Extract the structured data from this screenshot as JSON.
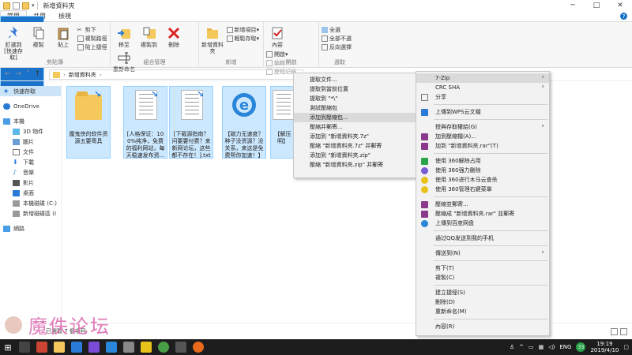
{
  "window": {
    "title": "新增資料夾",
    "controls": [
      "─",
      "□",
      "✕"
    ]
  },
  "tabs": [
    {
      "label": "檔案"
    },
    {
      "label": "常用"
    },
    {
      "label": "共用"
    },
    {
      "label": "檢視"
    }
  ],
  "ribbon": {
    "clipboard": {
      "group_label": "剪貼簿",
      "pin_label": "釘選到 [快速存取]",
      "copy_label": "複製",
      "paste_label": "貼上",
      "cut_label": "剪下",
      "copy_path_label": "複製路徑",
      "paste_shortcut_label": "貼上捷徑"
    },
    "organize": {
      "group_label": "組合管理",
      "move_label": "移至",
      "copy_to_label": "複製到",
      "delete_label": "刪除",
      "rename_label": "重新命名"
    },
    "new": {
      "group_label": "新增",
      "new_folder_label": "新增資料夾",
      "new_item_label": "新增項目",
      "easy_access_label": "輕鬆存取"
    },
    "open": {
      "group_label": "開啟",
      "properties_label": "內容",
      "open_label": "開啟",
      "edit_label": "編輯",
      "history_label": "歷程記錄"
    },
    "select": {
      "group_label": "選取",
      "select_all_label": "全選",
      "select_none_label": "全部不選",
      "invert_label": "反向選擇"
    }
  },
  "address": {
    "path": "新增資料夾"
  },
  "sidebar": {
    "items": [
      {
        "label": "快速存取",
        "icon": "star-icon"
      },
      {
        "label": "OneDrive",
        "icon": "cloud-icon"
      },
      {
        "label": "本機",
        "icon": "computer-icon"
      },
      {
        "label": "3D 物件",
        "icon": "cube-icon"
      },
      {
        "label": "圖片",
        "icon": "picture-icon"
      },
      {
        "label": "文件",
        "icon": "document-icon"
      },
      {
        "label": "下載",
        "icon": "download-icon"
      },
      {
        "label": "音樂",
        "icon": "music-icon"
      },
      {
        "label": "影片",
        "icon": "video-icon"
      },
      {
        "label": "桌面",
        "icon": "desktop-icon"
      },
      {
        "label": "本機磁碟 (C:)",
        "icon": "drive-icon"
      },
      {
        "label": "新增磁碟區 (I",
        "icon": "drive-icon"
      },
      {
        "label": "網路",
        "icon": "network-icon"
      }
    ]
  },
  "files": [
    {
      "name": "魔鬼侠的软件资源五要哥具",
      "kind": "folder-icon"
    },
    {
      "name": "[人格保证：100%纯净，免费的福利网站，每天稳速发布资...",
      "kind": "text-file-icon"
    },
    {
      "name": "[下载源指南？问要要付费？来新网论坛，这些都不存在！].txt",
      "kind": "text-file-icon"
    },
    {
      "name": "【磁力无速度？种子没资源？没关系，来这是免费帮你加速！】",
      "kind": "ie-shortcut-icon"
    },
    {
      "name": "【解压明】",
      "kind": "text-file-icon"
    }
  ],
  "status": {
    "text": "已選取 7 個項目"
  },
  "watermark": {
    "text": "魔佚论坛"
  },
  "menu_7zip": {
    "items": [
      "提取文件...",
      "提取到當前位置",
      "提取到 \"*\\\"",
      "測試壓縮包",
      "添加到壓縮包...",
      "壓縮并郵寄...",
      "添加到 \"新增資料夾.7z\"",
      "壓縮 \"新增資料夾.7z\" 并郵寄",
      "添加到 \"新增資料夾.zip\"",
      "壓縮 \"新增資料夾.zip\" 并郵寄"
    ]
  },
  "menu_main": {
    "items": [
      {
        "label": "7-Zip",
        "icon": "",
        "sub": true
      },
      {
        "label": "CRC SHA",
        "icon": "",
        "sub": true
      },
      {
        "label": "分享",
        "icon": "share-icon",
        "sub": false
      },
      {
        "label": "上傳到WPS云文檔",
        "icon": "wps-cloud-icon",
        "sub": false
      },
      {
        "label": "授與存取權給(G)",
        "icon": "",
        "sub": true
      },
      {
        "label": "加到壓縮檔(A)...",
        "icon": "winrar-icon",
        "sub": false
      },
      {
        "label": "加到 \"新增資料夾.rar\"(T)",
        "icon": "winrar-icon",
        "sub": false
      },
      {
        "label": "使用 360解除占用",
        "icon": "360-icon",
        "sub": false
      },
      {
        "label": "使用 360强力刪除",
        "icon": "360-icon",
        "sub": false
      },
      {
        "label": "使用 360进行木马云查杀",
        "icon": "360-icon",
        "sub": false
      },
      {
        "label": "使用 360管理右鍵菜單",
        "icon": "360-icon",
        "sub": false
      },
      {
        "label": "壓縮並郵寄...",
        "icon": "winrar-icon",
        "sub": false
      },
      {
        "label": "壓縮成 \"新增資料夾.rar\" 並郵寄",
        "icon": "winrar-icon",
        "sub": false
      },
      {
        "label": "上傳到百度网盘",
        "icon": "baidu-icon",
        "sub": false
      },
      {
        "label": "通过QQ发送到我的手机",
        "icon": "",
        "sub": false
      },
      {
        "label": "傳送到(N)",
        "icon": "",
        "sub": true
      },
      {
        "label": "剪下(T)",
        "icon": "",
        "sub": false
      },
      {
        "label": "複製(C)",
        "icon": "",
        "sub": false
      },
      {
        "label": "建立捷徑(S)",
        "icon": "",
        "sub": false
      },
      {
        "label": "刪除(D)",
        "icon": "",
        "sub": false
      },
      {
        "label": "重新命名(M)",
        "icon": "",
        "sub": false
      },
      {
        "label": "內容(R)",
        "icon": "",
        "sub": false
      }
    ]
  },
  "taskbar": {
    "lang": "ENG",
    "badge": "33",
    "time": "19:19",
    "date": "2019/4/10"
  },
  "colors": {
    "accent": "#1a73c8",
    "selection": "#cce8ff",
    "menu_bg": "#f2f2f2",
    "menu_highlight": "#dadada",
    "watermark": "#e07bb8"
  }
}
